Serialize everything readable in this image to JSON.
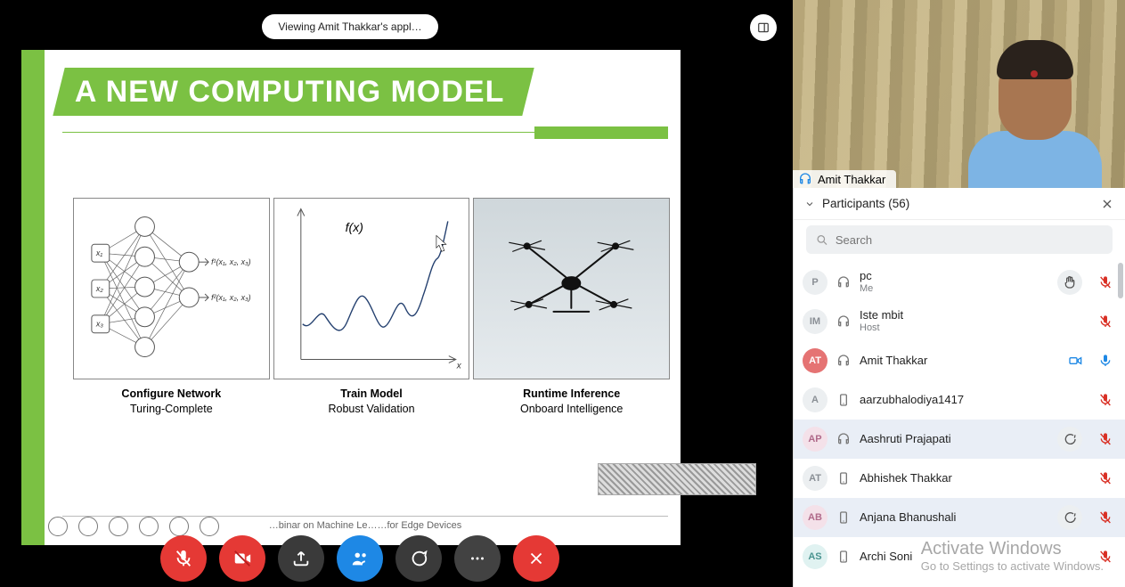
{
  "topbar": {
    "viewing_label": "Viewing Amit Thakkar's appl…"
  },
  "video": {
    "participant_name": "Amit Thakkar"
  },
  "slide": {
    "title": "A NEW COMPUTING MODEL",
    "fx_label": "f(x)",
    "cursor_visible": true,
    "cols": [
      {
        "heading": "Configure Network",
        "sub": "Turing-Complete"
      },
      {
        "heading": "Train Model",
        "sub": "Robust Validation"
      },
      {
        "heading": "Runtime Inference",
        "sub": "Onboard Intelligence"
      }
    ],
    "nn_labels": {
      "x1": "x₁",
      "x2": "x₂",
      "x3": "x₃",
      "f1": "f¹(x₁, x₂, x₃)",
      "f2": "f²(x₁, x₂, x₃)"
    },
    "footer": "…binar on Machine Le……for Edge Devices"
  },
  "chart_data": {
    "type": "line",
    "title": "f(x)",
    "xlabel": "x",
    "ylabel": "",
    "x": [
      0,
      8,
      16,
      24,
      32,
      40,
      48,
      56,
      64,
      72,
      80,
      88,
      96,
      104,
      112,
      120,
      128,
      136,
      144,
      150
    ],
    "values": [
      0.3,
      0.26,
      0.41,
      0.32,
      0.37,
      0.25,
      0.36,
      0.54,
      0.45,
      0.25,
      0.3,
      0.55,
      0.38,
      0.3,
      0.46,
      0.59,
      0.7,
      0.7,
      0.88,
      1.0
    ],
    "ylim": [
      0,
      1
    ]
  },
  "participants": {
    "header": "Participants (56)",
    "search_placeholder": "Search",
    "rows": [
      {
        "initials": "P",
        "av": "av-grey",
        "name": "pc",
        "sub": "Me",
        "device": "headset",
        "hand": true,
        "mic": "off",
        "cam": null,
        "chat": false
      },
      {
        "initials": "IM",
        "av": "av-grey",
        "name": "Iste mbit",
        "sub": "Host",
        "device": "headset",
        "hand": false,
        "mic": "off",
        "cam": null,
        "chat": false
      },
      {
        "initials": "AT",
        "av": "av-red",
        "name": "Amit Thakkar",
        "sub": "",
        "device": "headset",
        "hand": false,
        "mic": "on",
        "cam": "on",
        "chat": false
      },
      {
        "initials": "A",
        "av": "av-grey",
        "name": "aarzubhalodiya1417",
        "sub": "",
        "device": "phone",
        "hand": false,
        "mic": "off",
        "cam": null,
        "chat": false
      },
      {
        "initials": "AP",
        "av": "av-pink",
        "name": "Aashruti Prajapati",
        "sub": "",
        "device": "headset",
        "hand": false,
        "mic": "off",
        "cam": null,
        "chat": true,
        "selected": true
      },
      {
        "initials": "AT",
        "av": "av-grey",
        "name": "Abhishek Thakkar",
        "sub": "",
        "device": "phone",
        "hand": false,
        "mic": "off",
        "cam": null,
        "chat": false
      },
      {
        "initials": "AB",
        "av": "av-pink",
        "name": "Anjana Bhanushali",
        "sub": "",
        "device": "phone",
        "hand": false,
        "mic": "off",
        "cam": null,
        "chat": true,
        "selected": true
      },
      {
        "initials": "AS",
        "av": "av-teal",
        "name": "Archi Soni",
        "sub": "",
        "device": "phone",
        "hand": false,
        "mic": "off",
        "cam": null,
        "chat": false
      }
    ]
  },
  "watermark": {
    "line1": "Activate Windows",
    "line2": "Go to Settings to activate Windows."
  },
  "icons": {
    "headset": "🎧",
    "phone": "📱",
    "hand": "✋",
    "chat": "💬"
  }
}
